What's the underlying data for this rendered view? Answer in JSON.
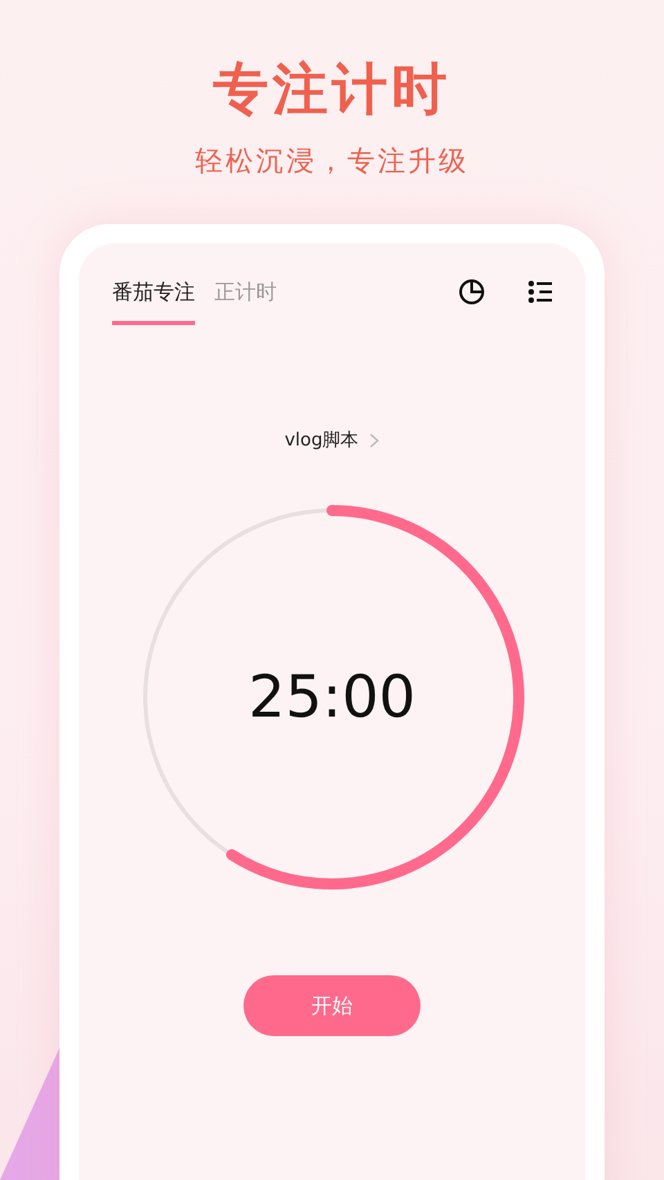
{
  "headline": "专注计时",
  "subtitle": "轻松沉浸，专注升级",
  "tabs": [
    {
      "label": "番茄专注",
      "selected": true
    },
    {
      "label": "正计时",
      "selected": false
    }
  ],
  "task": {
    "label": "vlog脚本"
  },
  "timer": {
    "time": "25:00",
    "level": 0.59
  },
  "start_button": {
    "label": "开始"
  }
}
